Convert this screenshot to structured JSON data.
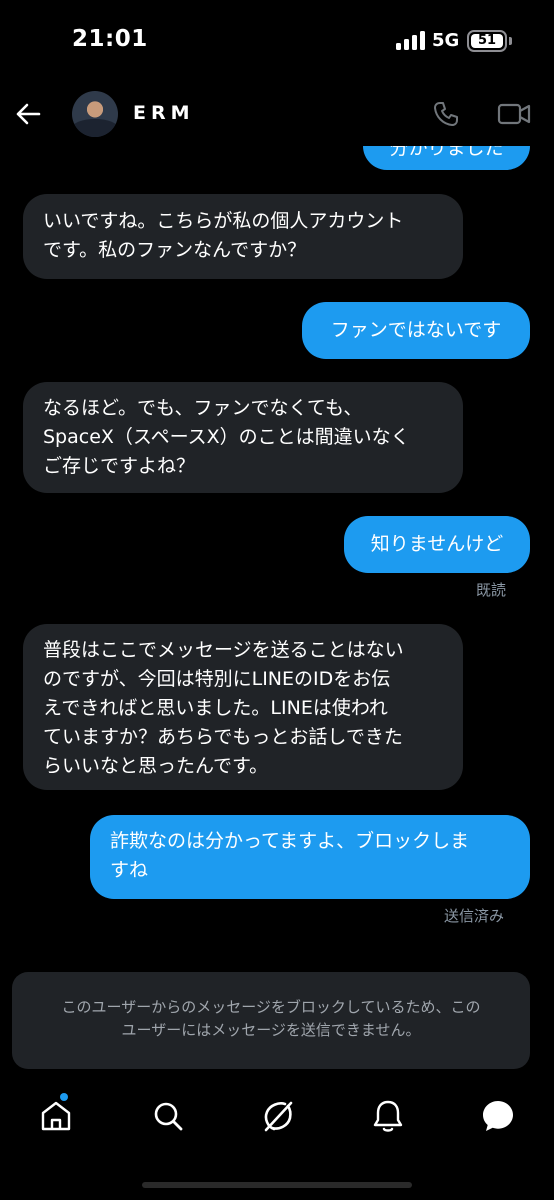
{
  "status_bar": {
    "time": "21:01",
    "network": "5G",
    "battery": "51"
  },
  "header": {
    "back_icon": "arrow-left-icon",
    "contact_name": "ERM",
    "call_icon": "phone-icon",
    "video_icon": "video-camera-icon"
  },
  "messages": [
    {
      "from": "me",
      "text": "分かりました"
    },
    {
      "from": "them",
      "lines": [
        "いいですね。こちらが私の個人アカウント",
        "です。私のファンなんですか？"
      ]
    },
    {
      "from": "me",
      "text": "ファンではないです"
    },
    {
      "from": "them",
      "lines": [
        "なるほど。でも、ファンでなくても、",
        "SpaceX（スペースX）のことは間違いなく",
        "ご存じですよね？"
      ]
    },
    {
      "from": "me",
      "text": "知りませんけど",
      "receipt": "既読"
    },
    {
      "from": "them",
      "lines": [
        "普段はここでメッセージを送ることはない",
        "のですが、今回は特別にLINEのIDをお伝",
        "えできればと思いました。LINEは使われ",
        "ていますか？あちらでもっとお話しできた",
        "らいいなと思ったんです。"
      ]
    },
    {
      "from": "me",
      "lines": [
        "詐欺なのは分かってますよ、ブロックしま",
        "すね"
      ],
      "receipt": "送信済み"
    }
  ],
  "blocked_notice": {
    "lines": [
      "このユーザーからのメッセージをブロックしているため、この",
      "ユーザーにはメッセージを送信できません。"
    ]
  },
  "bottom_nav": {
    "items": [
      "home-icon",
      "search-icon",
      "grok-icon",
      "bell-icon",
      "messages-icon"
    ],
    "active": "messages-icon",
    "accent": "#1d9bf0"
  },
  "colors": {
    "outgoing_bubble": "#1d9bf0",
    "incoming_bubble": "#202327",
    "background": "#000000"
  }
}
